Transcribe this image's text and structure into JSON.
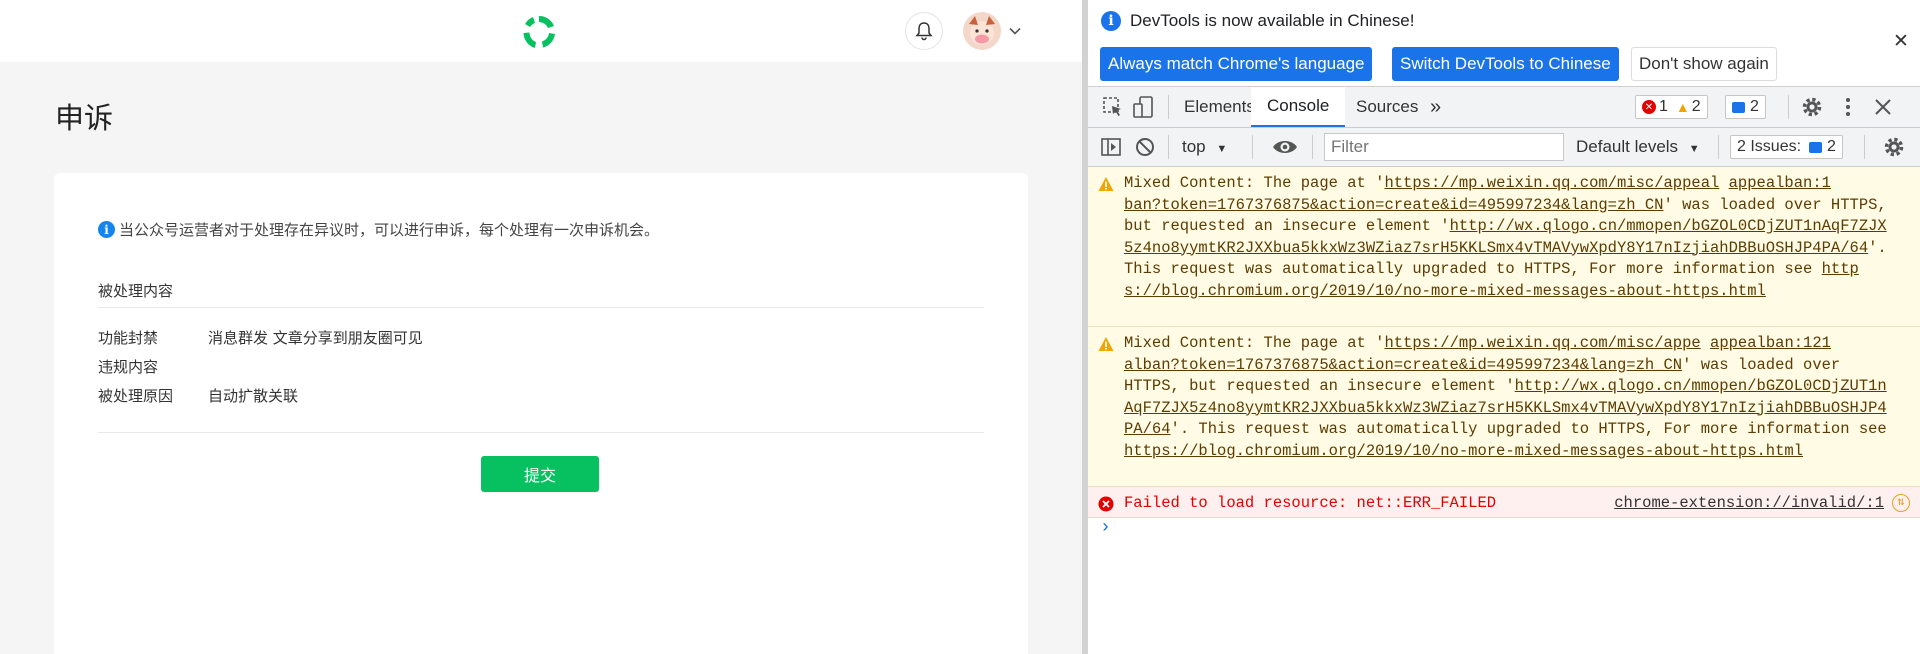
{
  "page": {
    "title": "申诉",
    "notice": "当公众号运营者对于处理存在异议时，可以进行申诉，每个处理有一次申诉机会。",
    "section_title": "被处理内容",
    "rows": [
      {
        "label": "功能封禁",
        "value": "消息群发 文章分享到朋友圈可见"
      },
      {
        "label": "违规内容",
        "value": ""
      },
      {
        "label": "被处理原因",
        "value": "自动扩散关联"
      }
    ],
    "submit_label": "提交",
    "colors": {
      "brand_green": "#07c160",
      "info_blue": "#1485ee"
    }
  },
  "devtools": {
    "infobar": {
      "message": "DevTools is now available in Chinese!",
      "btn_match": "Always match Chrome's language",
      "btn_switch": "Switch DevTools to Chinese",
      "btn_dismiss": "Don't show again"
    },
    "tabs": {
      "elements": "Elements",
      "console": "Console",
      "sources": "Sources",
      "more": "»"
    },
    "counts": {
      "errors": "1",
      "warnings": "2",
      "messages": "2"
    },
    "toolbar": {
      "context": "top",
      "filter_placeholder": "Filter",
      "levels": "Default levels",
      "issues_label": "2 Issues:",
      "issues_count": "2"
    },
    "messages": [
      {
        "type": "warning",
        "prefix": "Mixed Content: The page at '",
        "page_url": "https://mp.weixin.qq.com/misc/appeal",
        "source": "appealban:1",
        "page_url_cont": "ban?token=1767376875&action=create&id=495997234&lang=zh_CN",
        "mid": "' was loaded over HTTPS, but requested an insecure element '",
        "element_url": "http://wx.qlogo.cn/mmopen/bGZOL0CDjZUT1nAqF7ZJX5z4no8yymtKR2JXXbua5kkxWz3WZiaz7srH5KKLSmx4vTMAVywXpdY8Y17nIzjiahDBBuOSHJP4PA/64",
        "tail": "'. This request was automatically upgraded to HTTPS, For more information see ",
        "info_url": "https://blog.chromium.org/2019/10/no-more-mixed-messages-about-https.html"
      },
      {
        "type": "warning",
        "prefix": "Mixed Content: The page at '",
        "page_url": "https://mp.weixin.qq.com/misc/appe",
        "source": "appealban:121",
        "page_url_cont": "alban?token=1767376875&action=create&id=495997234&lang=zh_CN",
        "mid": "' was loaded over HTTPS, but requested an insecure element '",
        "element_url": "http://wx.qlogo.cn/mmopen/bGZOL0CDjZUT1nAqF7ZJX5z4no8yymtKR2JXXbua5kkxWz3WZiaz7srH5KKLSmx4vTMAVywXpdY8Y17nIzjiahDBBuOSHJP4PA/64",
        "tail": "'. This request was automatically upgraded to HTTPS, For more information see ",
        "info_url": "https://blog.chromium.org/2019/10/no-more-mixed-messages-about-https.html"
      },
      {
        "type": "error",
        "text": "Failed to load resource: net::ERR_FAILED",
        "source": "chrome-extension://invalid/:1"
      }
    ],
    "prompt": "›",
    "colors": {
      "accent": "#1a73e8",
      "warning_bg": "#fffbe5",
      "error_text": "#e50000"
    }
  }
}
